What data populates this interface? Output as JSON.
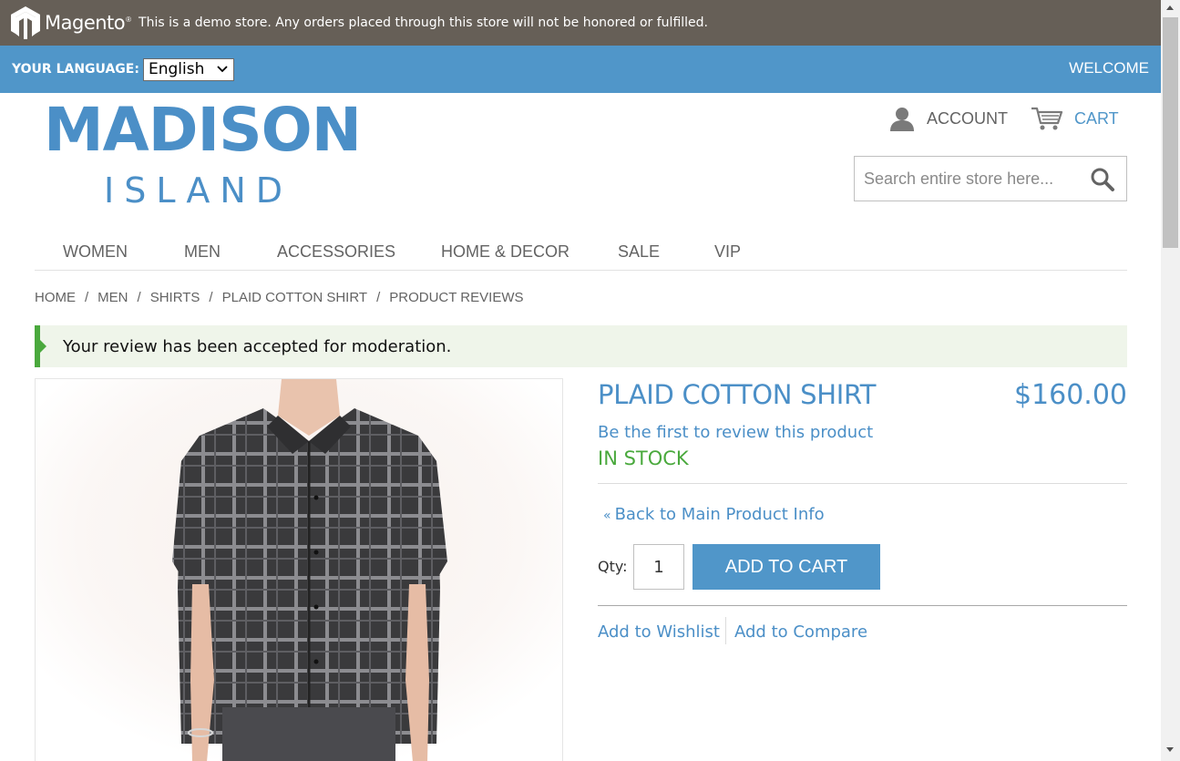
{
  "demo_notice": {
    "brand": "Magento",
    "trademark": "®",
    "text": "This is a demo store. Any orders placed through this store will not be honored or fulfilled."
  },
  "top_bar": {
    "language_label": "Your Language:",
    "language_selected": "English",
    "welcome": "WELCOME"
  },
  "header": {
    "logo_line1": "MADISON",
    "logo_line2": "ISLAND",
    "account_label": "ACCOUNT",
    "cart_label": "CART",
    "search_placeholder": "Search entire store here..."
  },
  "nav": {
    "items": [
      "Women",
      "Men",
      "Accessories",
      "Home & Decor",
      "Sale",
      "VIP"
    ]
  },
  "breadcrumbs": [
    "Home",
    "Men",
    "Shirts",
    "Plaid Cotton Shirt",
    "Product Reviews"
  ],
  "message": {
    "text": "Your review has been accepted for moderation."
  },
  "product": {
    "name": "Plaid Cotton Shirt",
    "price": "$160.00",
    "review_link": "Be the first to review this product",
    "stock": "In stock",
    "back_link": "Back to Main Product Info",
    "back_glyph": "«",
    "qty_label": "Qty:",
    "qty_value": "1",
    "add_to_cart": "Add to Cart",
    "wishlist": "Add to Wishlist",
    "compare": "Add to Compare"
  },
  "colors": {
    "demo_bar": "#665f57",
    "accent_blue": "#5096c9",
    "stock_green": "#4aa93d",
    "message_bg": "#eff5ea"
  }
}
